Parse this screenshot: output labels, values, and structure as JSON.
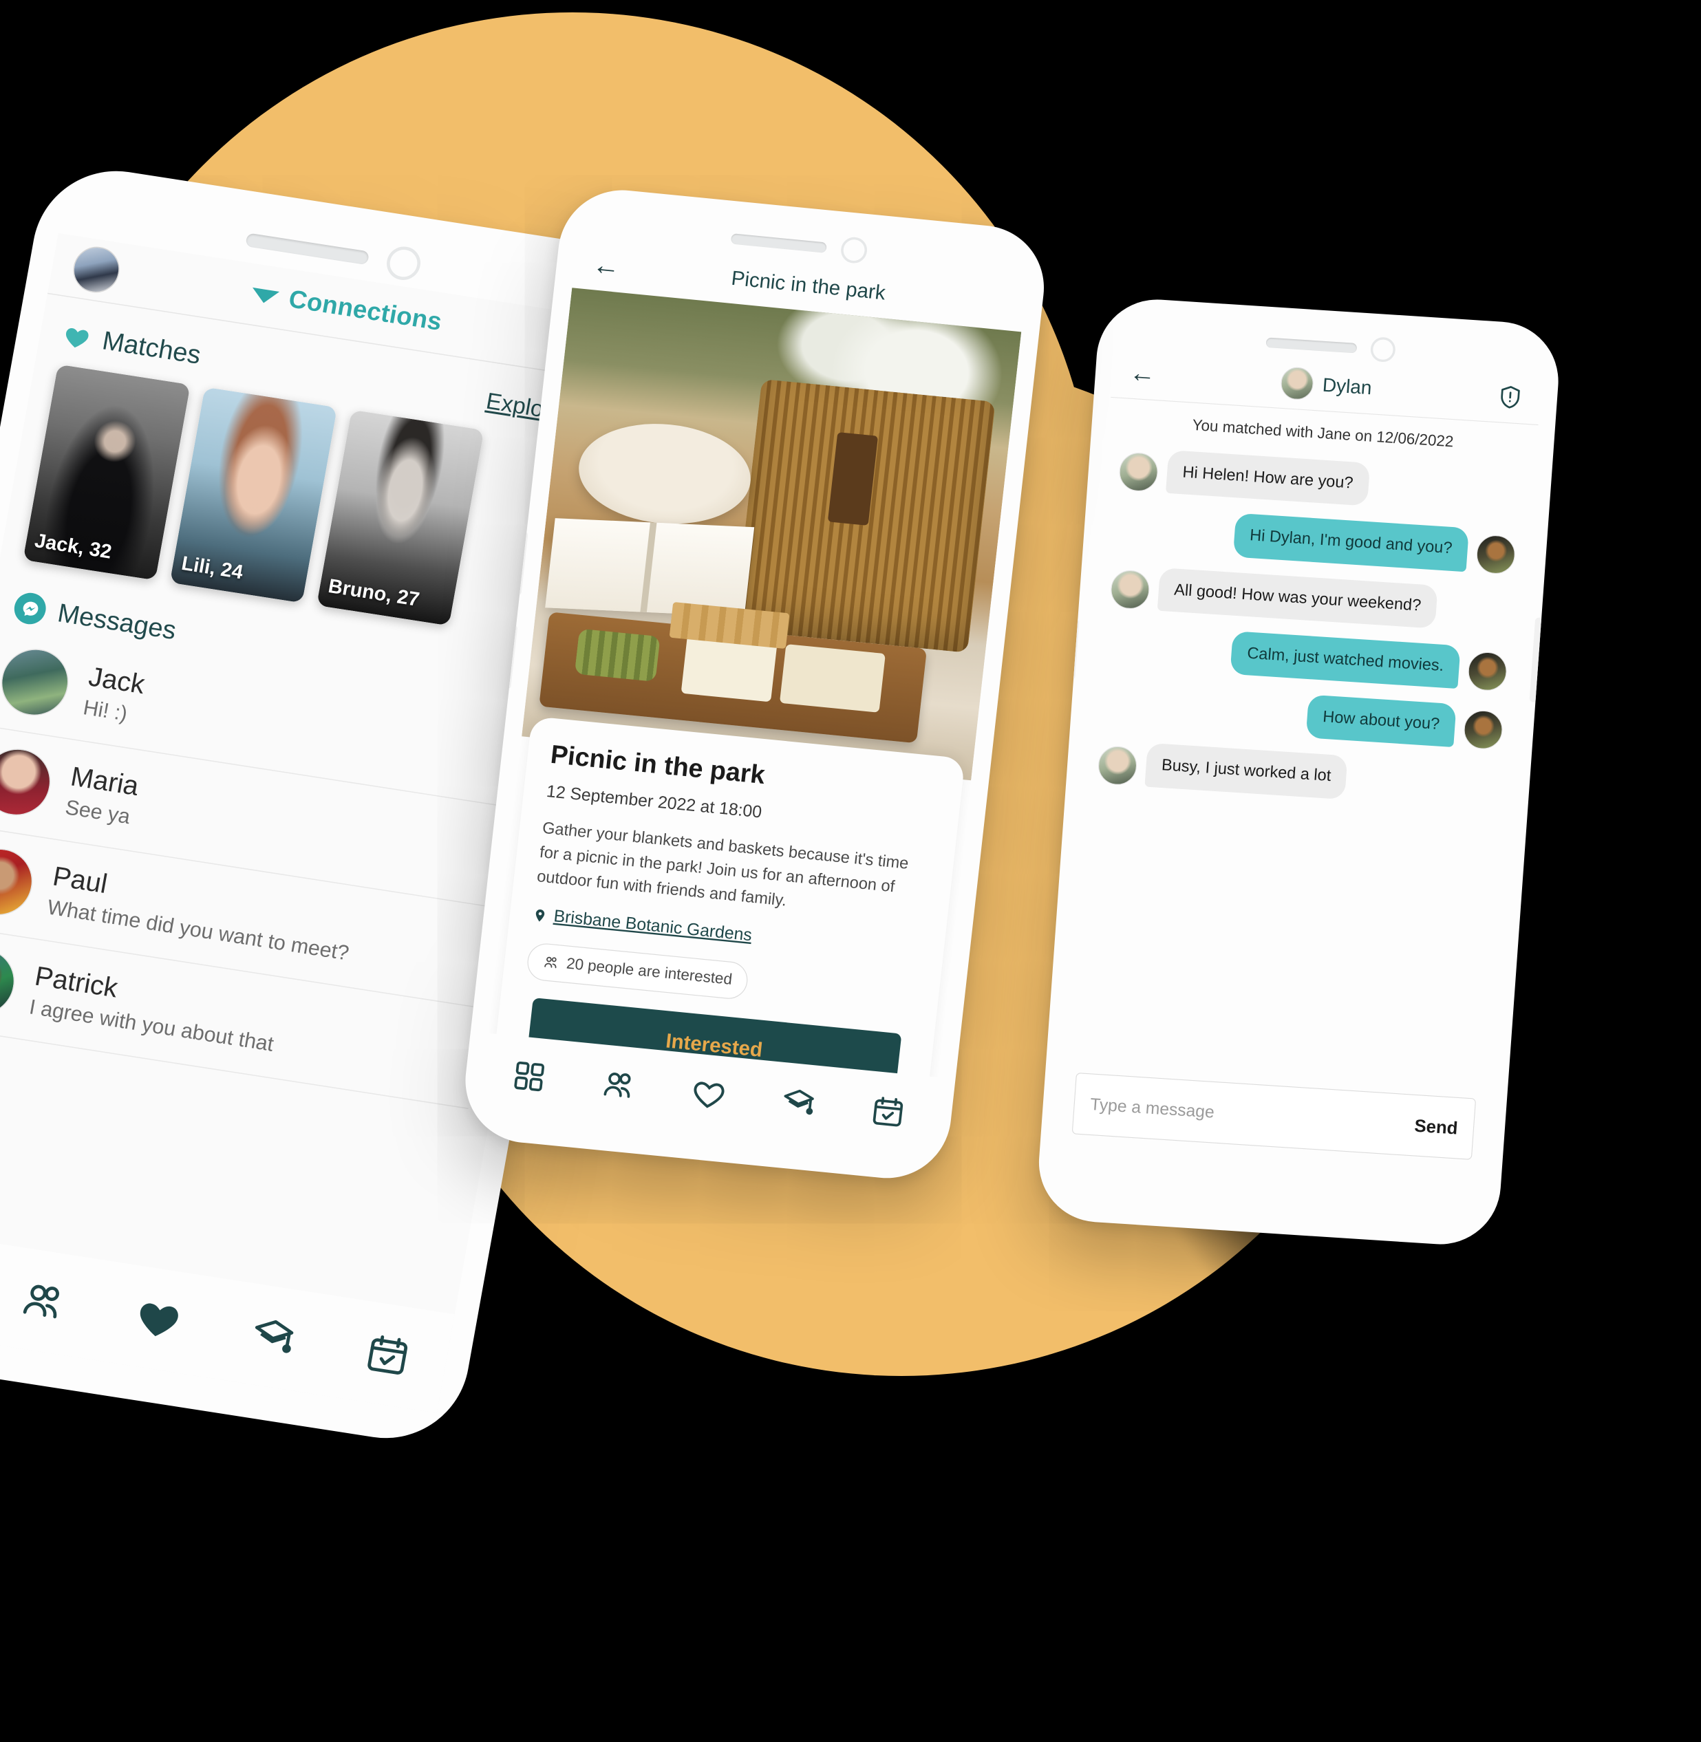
{
  "theme": {
    "background": "#000000",
    "blob_color": "#f2be6a",
    "teal": "#2fa8a8",
    "dark_teal": "#1d4a4b",
    "accent_gold": "#e6a84b",
    "bubble_me": "#58c6ca",
    "bubble_them": "#ececec"
  },
  "phone1": {
    "header": {
      "avatar_name": "user-avatar",
      "caret_icon": "chevron-down-icon",
      "title": "Connections"
    },
    "matches": {
      "icon": "heart-icon",
      "label": "Matches",
      "explore_label": "Explore all",
      "cards": [
        {
          "name": "Jack, 32"
        },
        {
          "name": "Lili, 24"
        },
        {
          "name": "Bruno, 27"
        }
      ]
    },
    "messages": {
      "icon": "messenger-icon",
      "label": "Messages",
      "items": [
        {
          "name": "Jack",
          "preview": "Hi! :)"
        },
        {
          "name": "Maria",
          "preview": "See ya"
        },
        {
          "name": "Paul",
          "preview": "What time did you want to meet?"
        },
        {
          "name": "Patrick",
          "preview": "I agree with you about that"
        }
      ]
    },
    "nav": [
      {
        "icon": "grid-icon",
        "active": false
      },
      {
        "icon": "people-icon",
        "active": false
      },
      {
        "icon": "heart-icon",
        "active": true
      },
      {
        "icon": "graduation-cap-icon",
        "active": false
      },
      {
        "icon": "calendar-check-icon",
        "active": false
      }
    ]
  },
  "phone2": {
    "header": {
      "back_icon": "back-arrow-icon",
      "title": "Picnic in the park"
    },
    "hero_alt": "picnic-basket-photo",
    "event": {
      "title": "Picnic in the park",
      "date": "12 September 2022 at 18:00",
      "description": "Gather your blankets and baskets because it's time for a picnic in the park! Join us for an afternoon of outdoor fun with friends and family.",
      "location_icon": "map-pin-icon",
      "location": "Brisbane Botanic Gardens",
      "interested_icon": "people-icon",
      "interested_count": "20 people are interested",
      "cta_label": "Interested"
    },
    "nav": [
      {
        "icon": "grid-icon",
        "active": false
      },
      {
        "icon": "people-icon",
        "active": false
      },
      {
        "icon": "heart-icon",
        "active": false
      },
      {
        "icon": "graduation-cap-icon",
        "active": false
      },
      {
        "icon": "calendar-check-icon",
        "active": false
      }
    ]
  },
  "phone3": {
    "header": {
      "back_icon": "back-arrow-icon",
      "avatar_name": "dylan-avatar",
      "name": "Dylan",
      "report_icon": "shield-alert-icon"
    },
    "match_note": "You matched with Jane on 12/06/2022",
    "messages": [
      {
        "from": "them",
        "text": "Hi Helen! How are you?"
      },
      {
        "from": "me",
        "text": "Hi Dylan, I'm good and you?"
      },
      {
        "from": "them",
        "text": "All good! How was your weekend?"
      },
      {
        "from": "me",
        "text": "Calm, just watched movies."
      },
      {
        "from": "me",
        "text": "How about you?"
      },
      {
        "from": "them",
        "text": "Busy, I just worked a lot"
      }
    ],
    "composer": {
      "placeholder": "Type a message",
      "send_label": "Send"
    }
  }
}
